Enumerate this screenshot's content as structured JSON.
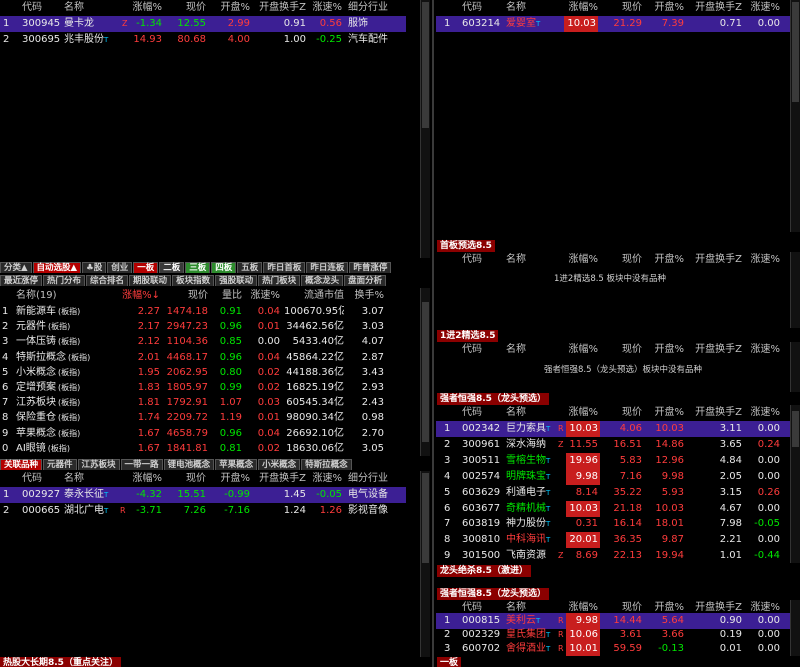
{
  "top_left": {
    "headers": [
      "代码",
      "名称",
      "涨幅%",
      "现价",
      "开盘%",
      "开盘换手Z",
      "涨速%",
      "细分行业"
    ],
    "rows": [
      {
        "idx": "1",
        "code": "300945",
        "name": "曼卡龙",
        "tag": "",
        "letter": "Z",
        "chg": "-1.34",
        "price": "12.55",
        "open": "2.99",
        "turnover": "0.91",
        "speed": "0.56",
        "industry": "服饰"
      },
      {
        "idx": "2",
        "code": "300695",
        "name": "兆丰股份",
        "tag": "T",
        "letter": "",
        "chg": "14.93",
        "price": "80.68",
        "open": "4.00",
        "turnover": "1.00",
        "speed": "-0.25",
        "industry": "汽车配件"
      }
    ]
  },
  "top_right": {
    "headers": [
      "代码",
      "名称",
      "涨幅%",
      "现价",
      "开盘%",
      "开盘换手Z",
      "涨速%"
    ],
    "rows": [
      {
        "idx": "1",
        "code": "603214",
        "name": "爱婴室",
        "tag": "T",
        "chg": "10.03",
        "price": "21.29",
        "open": "7.39",
        "turnover": "0.71",
        "speed": "0.00"
      }
    ]
  },
  "tabs_row1": [
    "分类▲",
    "自动选股▲",
    "♣股",
    "创业",
    "一板",
    "二板",
    "三板",
    "四板",
    "五板",
    "昨日首板",
    "昨日连板",
    "昨曾涨停"
  ],
  "tabs_row2": [
    "最近涨停",
    "热门分布",
    "综合排名",
    "期股联动",
    "板块指数",
    "强股联动",
    "热门板块",
    "概念龙头",
    "盘面分析"
  ],
  "sector_table": {
    "headers": [
      "名称(19)",
      "涨幅%↓",
      "现价",
      "量比",
      "涨速%",
      "流通市值",
      "换手%"
    ],
    "rows": [
      {
        "idx": "1",
        "name": "新能源车",
        "suffix": "(板指)",
        "chg": "2.27",
        "price": "1474.18",
        "vr": "0.91",
        "speed": "0.04",
        "mcap": "100670.95亿",
        "turn": "3.07"
      },
      {
        "idx": "2",
        "name": "元器件",
        "suffix": "(板指)",
        "chg": "2.17",
        "price": "2947.23",
        "vr": "0.96",
        "speed": "0.01",
        "mcap": "34462.56亿",
        "turn": "3.03"
      },
      {
        "idx": "3",
        "name": "一体压铸",
        "suffix": "(板指)",
        "chg": "2.12",
        "price": "1104.36",
        "vr": "0.85",
        "speed": "0.00",
        "mcap": "5433.40亿",
        "turn": "4.07"
      },
      {
        "idx": "4",
        "name": "特斯拉概念",
        "suffix": "(板指)",
        "chg": "2.01",
        "price": "4468.17",
        "vr": "0.96",
        "speed": "0.04",
        "mcap": "45864.22亿",
        "turn": "2.87"
      },
      {
        "idx": "5",
        "name": "小米概念",
        "suffix": "(板指)",
        "chg": "1.95",
        "price": "2062.95",
        "vr": "0.80",
        "speed": "0.02",
        "mcap": "44188.36亿",
        "turn": "3.43"
      },
      {
        "idx": "6",
        "name": "定增预案",
        "suffix": "(板指)",
        "chg": "1.83",
        "price": "1805.97",
        "vr": "0.99",
        "speed": "0.02",
        "mcap": "16825.19亿",
        "turn": "2.93"
      },
      {
        "idx": "7",
        "name": "江苏板块",
        "suffix": "(板指)",
        "chg": "1.81",
        "price": "1792.91",
        "vr": "1.07",
        "speed": "0.03",
        "mcap": "60545.34亿",
        "turn": "2.43"
      },
      {
        "idx": "8",
        "name": "保险重仓",
        "suffix": "(板指)",
        "chg": "1.74",
        "price": "2209.72",
        "vr": "1.19",
        "speed": "0.01",
        "mcap": "98090.34亿",
        "turn": "0.98"
      },
      {
        "idx": "9",
        "name": "苹果概念",
        "suffix": "(板指)",
        "chg": "1.67",
        "price": "4658.79",
        "vr": "0.96",
        "speed": "0.04",
        "mcap": "26692.10亿",
        "turn": "2.70"
      },
      {
        "idx": "0",
        "name": "AI眼镜",
        "suffix": "(板指)",
        "chg": "1.67",
        "price": "1841.81",
        "vr": "0.81",
        "speed": "0.02",
        "mcap": "18630.06亿",
        "turn": "3.05"
      }
    ]
  },
  "related_tabs": [
    "关联品种",
    "元器件",
    "江苏板块",
    "一带一路",
    "锂电池概念",
    "苹果概念",
    "小米概念",
    "特斯拉概念"
  ],
  "related_table": {
    "headers": [
      "代码",
      "名称",
      "涨幅%",
      "现价",
      "开盘%",
      "开盘换手Z",
      "涨速%",
      "细分行业"
    ],
    "rows": [
      {
        "idx": "1",
        "code": "002927",
        "name": "泰永长征",
        "tag": "T",
        "letter": "",
        "chg": "-4.32",
        "price": "15.51",
        "open": "-0.99",
        "turnover": "1.45",
        "speed": "-0.05",
        "industry": "电气设备"
      },
      {
        "idx": "2",
        "code": "000665",
        "name": "湖北广电",
        "tag": "T",
        "letter": "R",
        "chg": "-3.71",
        "price": "7.26",
        "open": "-7.16",
        "turnover": "1.24",
        "speed": "1.26",
        "industry": "影视音像"
      }
    ]
  },
  "bottom_left_title": "热股大长期8.5（重点关注）",
  "panel_shouban": {
    "title": "首板预选8.5",
    "headers": [
      "代码",
      "名称",
      "涨幅%",
      "现价",
      "开盘%",
      "开盘换手Z",
      "涨速%"
    ],
    "message": "1进2精选8.5 板块中没有品种"
  },
  "panel_jinjing": {
    "title": "1进2精选8.5",
    "headers": [
      "代码",
      "名称",
      "涨幅%",
      "现价",
      "开盘%",
      "开盘换手Z",
      "涨速%"
    ],
    "message": "强者恒强8.5（龙头预选）板块中没有品种"
  },
  "panel_qiangzhe": {
    "title": "强者恒强8.5（龙头预选）",
    "headers": [
      "代码",
      "名称",
      "涨幅%",
      "现价",
      "开盘%",
      "开盘换手Z",
      "涨速%"
    ],
    "rows": [
      {
        "idx": "1",
        "code": "002342",
        "name": "巨力索具",
        "tag": "T",
        "letter": "R",
        "chg": "10.03",
        "price": "4.06",
        "open": "10.03",
        "turnover": "3.11",
        "speed": "0.00",
        "sel": true,
        "box": true,
        "nameColor": "white"
      },
      {
        "idx": "2",
        "code": "300961",
        "name": "深水海纳",
        "tag": "",
        "letter": "Z",
        "chg": "11.55",
        "price": "16.51",
        "open": "14.86",
        "turnover": "3.65",
        "speed": "0.24",
        "box": false,
        "nameColor": "white"
      },
      {
        "idx": "3",
        "code": "300511",
        "name": "雪榕生物",
        "tag": "T",
        "letter": "",
        "chg": "19.96",
        "price": "5.83",
        "open": "12.96",
        "turnover": "4.84",
        "speed": "0.00",
        "box": true,
        "nameColor": "green"
      },
      {
        "idx": "4",
        "code": "002574",
        "name": "明牌珠宝",
        "tag": "T",
        "letter": "",
        "chg": "9.98",
        "price": "7.16",
        "open": "9.98",
        "turnover": "2.05",
        "speed": "0.00",
        "box": true,
        "nameColor": "green"
      },
      {
        "idx": "5",
        "code": "603629",
        "name": "利通电子",
        "tag": "T",
        "letter": "",
        "chg": "8.14",
        "price": "35.22",
        "open": "5.93",
        "turnover": "3.15",
        "speed": "0.26",
        "box": false,
        "nameColor": "white"
      },
      {
        "idx": "6",
        "code": "603677",
        "name": "奇精机械",
        "tag": "T",
        "letter": "",
        "chg": "10.03",
        "price": "21.18",
        "open": "10.03",
        "turnover": "4.67",
        "speed": "0.00",
        "box": true,
        "nameColor": "green"
      },
      {
        "idx": "7",
        "code": "603819",
        "name": "神力股份",
        "tag": "T",
        "letter": "",
        "chg": "0.31",
        "price": "16.14",
        "open": "18.01",
        "turnover": "7.98",
        "speed": "-0.05",
        "box": false,
        "nameColor": "white"
      },
      {
        "idx": "8",
        "code": "300810",
        "name": "中科海讯",
        "tag": "T",
        "letter": "",
        "chg": "20.01",
        "price": "36.35",
        "open": "9.87",
        "turnover": "2.21",
        "speed": "0.00",
        "box": true,
        "nameColor": "red"
      },
      {
        "idx": "9",
        "code": "301500",
        "name": "飞南资源",
        "tag": "",
        "letter": "Z",
        "chg": "8.69",
        "price": "22.13",
        "open": "19.94",
        "turnover": "1.01",
        "speed": "-0.44",
        "box": false,
        "nameColor": "white"
      }
    ]
  },
  "panel_longtou_title": "龙头绝杀8.5（激进）",
  "panel_qiangzhe2": {
    "title": "强者恒强8.5（龙头预选）",
    "headers": [
      "代码",
      "名称",
      "涨幅%",
      "现价",
      "开盘%",
      "开盘换手Z",
      "涨速%"
    ],
    "rows": [
      {
        "idx": "1",
        "code": "000815",
        "name": "美利云",
        "tag": "T",
        "letter": "R",
        "chg": "9.98",
        "price": "14.44",
        "open": "5.64",
        "turnover": "0.90",
        "speed": "0.00",
        "sel": true,
        "box": true,
        "nameColor": "red"
      },
      {
        "idx": "2",
        "code": "002329",
        "name": "皇氏集团",
        "tag": "T",
        "letter": "R",
        "chg": "10.06",
        "price": "3.61",
        "open": "3.66",
        "turnover": "0.19",
        "speed": "0.00",
        "box": true,
        "nameColor": "red"
      },
      {
        "idx": "3",
        "code": "600702",
        "name": "舍得酒业",
        "tag": "T",
        "letter": "R",
        "chg": "10.01",
        "price": "59.59",
        "open": "-0.13",
        "turnover": "0.01",
        "speed": "0.00",
        "box": true,
        "nameColor": "red"
      }
    ]
  },
  "bottom_right_tab": "一板"
}
